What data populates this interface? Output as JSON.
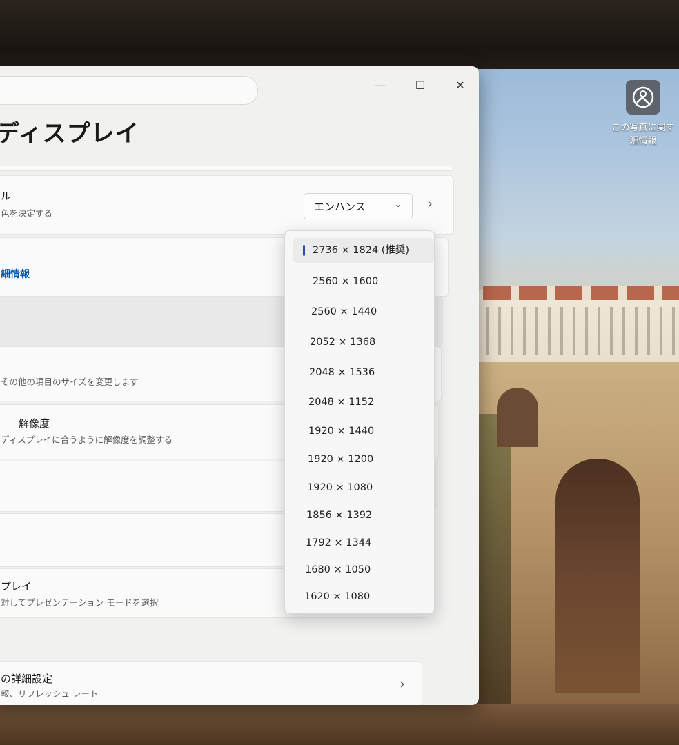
{
  "window": {
    "title": "ディスプレイ",
    "controls": {
      "minimize": "—",
      "maximize": "☐",
      "close": "✕"
    }
  },
  "settings": {
    "color_profile": {
      "title_fragment": "ル",
      "subtitle_fragment": "色を決定する",
      "value": "エンハンス"
    },
    "details_link": "細情報",
    "size": {
      "subtitle_fragment": "その他の項目のサイズを変更します"
    },
    "resolution": {
      "title_fragment": "解像度",
      "subtitle_fragment": "ディスプレイに合うように解像度を調整する"
    },
    "presentation": {
      "title_fragment": "プレイ",
      "subtitle_fragment": "対してプレゼンテーション モードを選択"
    },
    "advanced": {
      "title_fragment": "の詳細設定",
      "subtitle_fragment": "報、リフレッシュ レート"
    }
  },
  "resolution_dropdown": {
    "options": [
      "2736 × 1824 (推奨)",
      "2560 × 1600",
      "2560 × 1440",
      "2052 × 1368",
      "2048 × 1536",
      "2048 × 1152",
      "1920 × 1440",
      "1920 × 1200",
      "1920 × 1080",
      "1856 × 1392",
      "1792 × 1344",
      "1680 × 1050",
      "1620 × 1080"
    ],
    "selected_index": 0,
    "accent_color": "#2a4fa8"
  },
  "desktop": {
    "photo_info_label": "この写真に関す\n細情報"
  }
}
